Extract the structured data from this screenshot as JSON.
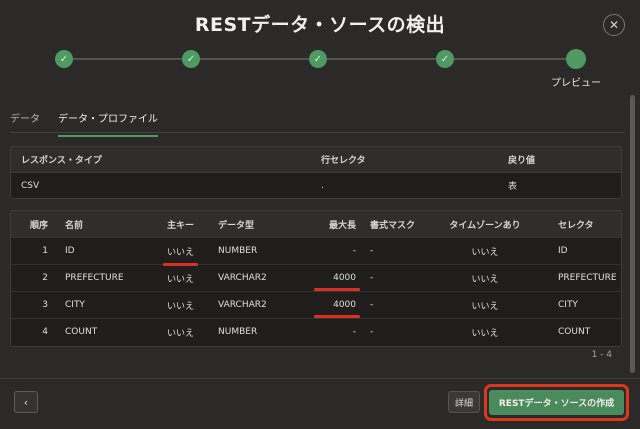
{
  "dialog": {
    "title": "RESTデータ・ソースの検出",
    "close_glyph": "✕"
  },
  "stepper": {
    "steps": [
      {
        "state": "done",
        "glyph": "✓"
      },
      {
        "state": "done",
        "glyph": "✓"
      },
      {
        "state": "done",
        "glyph": "✓"
      },
      {
        "state": "done",
        "glyph": "✓"
      },
      {
        "state": "current",
        "glyph": ""
      }
    ],
    "current_label": "プレビュー"
  },
  "tabs": [
    {
      "label": "データ",
      "active": false
    },
    {
      "label": "データ・プロファイル",
      "active": true
    }
  ],
  "response_table": {
    "headers": [
      "レスポンス・タイプ",
      "行セレクタ",
      "戻り値"
    ],
    "row": [
      "CSV",
      ".",
      "表"
    ]
  },
  "profile_table": {
    "headers": [
      "順序",
      "名前",
      "主キー",
      "データ型",
      "最大長",
      "書式マスク",
      "タイムゾーンあり",
      "セレクタ"
    ],
    "rows": [
      [
        "1",
        "ID",
        "いいえ",
        "NUMBER",
        "-",
        "-",
        "いいえ",
        "ID"
      ],
      [
        "2",
        "PREFECTURE",
        "いいえ",
        "VARCHAR2",
        "4000",
        "-",
        "いいえ",
        "PREFECTURE"
      ],
      [
        "3",
        "CITY",
        "いいえ",
        "VARCHAR2",
        "4000",
        "-",
        "いいえ",
        "CITY"
      ],
      [
        "4",
        "COUNT",
        "いいえ",
        "NUMBER",
        "-",
        "-",
        "いいえ",
        "COUNT"
      ]
    ],
    "pagination": "1 - 4"
  },
  "footer": {
    "back_glyph": "‹",
    "detail_label": "詳細",
    "create_label": "RESTデータ・ソースの作成"
  },
  "colors": {
    "accent_green": "#4e9a62",
    "highlight_red": "#d9381e"
  }
}
